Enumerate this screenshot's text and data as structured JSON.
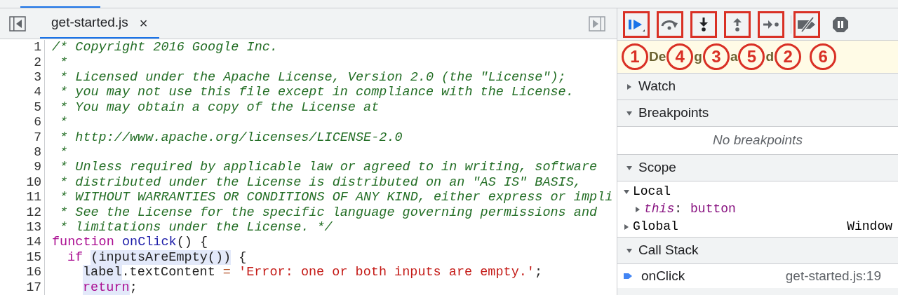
{
  "editor": {
    "tabs": [
      {
        "label": "get-started.js",
        "close": "×",
        "selected": true
      }
    ],
    "lines": [
      {
        "number": "1",
        "tokens": [
          {
            "text": "/* Copyright 2016 Google Inc.",
            "kind": "comment",
            "marked": false
          }
        ]
      },
      {
        "number": "2",
        "tokens": [
          {
            "text": " *",
            "kind": "comment",
            "marked": false
          }
        ]
      },
      {
        "number": "3",
        "tokens": [
          {
            "text": " * Licensed under the Apache License, Version 2.0 (the \"License\");",
            "kind": "comment",
            "marked": false
          }
        ]
      },
      {
        "number": "4",
        "tokens": [
          {
            "text": " * you may not use this file except in compliance with the License.",
            "kind": "comment",
            "marked": false
          }
        ]
      },
      {
        "number": "5",
        "tokens": [
          {
            "text": " * You may obtain a copy of the License at",
            "kind": "comment",
            "marked": false
          }
        ]
      },
      {
        "number": "6",
        "tokens": [
          {
            "text": " *",
            "kind": "comment",
            "marked": false
          }
        ]
      },
      {
        "number": "7",
        "tokens": [
          {
            "text": " * http://www.apache.org/licenses/LICENSE-2.0",
            "kind": "comment",
            "marked": false
          }
        ]
      },
      {
        "number": "8",
        "tokens": [
          {
            "text": " *",
            "kind": "comment",
            "marked": false
          }
        ]
      },
      {
        "number": "9",
        "tokens": [
          {
            "text": " * Unless required by applicable law or agreed to in writing, software",
            "kind": "comment",
            "marked": false
          }
        ]
      },
      {
        "number": "10",
        "tokens": [
          {
            "text": " * distributed under the License is distributed on an \"AS IS\" BASIS,",
            "kind": "comment",
            "marked": false
          }
        ]
      },
      {
        "number": "11",
        "tokens": [
          {
            "text": " * WITHOUT WARRANTIES OR CONDITIONS OF ANY KIND, either express or impli",
            "kind": "comment",
            "marked": false
          }
        ]
      },
      {
        "number": "12",
        "tokens": [
          {
            "text": " * See the License for the specific language governing permissions and",
            "kind": "comment",
            "marked": false
          }
        ]
      },
      {
        "number": "13",
        "tokens": [
          {
            "text": " * limitations under the License. */",
            "kind": "comment",
            "marked": false
          }
        ]
      },
      {
        "number": "14",
        "tokens": [
          {
            "text": "function ",
            "kind": "keyword",
            "marked": false
          },
          {
            "text": "onClick",
            "kind": "def",
            "marked": false
          },
          {
            "text": "() {",
            "kind": "plain",
            "marked": false
          }
        ],
        "children": [
          {
            "number": "15",
            "tokens": [
              {
                "text": "if ",
                "kind": "keyword",
                "marked": false
              },
              {
                "text": "(inputsAreEmpty())",
                "kind": "plain",
                "marked": true
              },
              {
                "text": " {",
                "kind": "plain",
                "marked": false
              }
            ],
            "children": [
              {
                "number": "16",
                "tokens": [
                  {
                    "text": "label",
                    "kind": "plain",
                    "marked": true
                  },
                  {
                    "text": ".textContent ",
                    "kind": "plain",
                    "marked": false
                  },
                  {
                    "text": "= ",
                    "kind": "operator",
                    "marked": false
                  },
                  {
                    "text": "'Error: one or both inputs are empty.'",
                    "kind": "string",
                    "marked": false
                  },
                  {
                    "text": ";",
                    "kind": "plain",
                    "marked": false
                  }
                ]
              },
              {
                "number": "17",
                "tokens": [
                  {
                    "text": "return",
                    "kind": "keyword",
                    "marked": true
                  },
                  {
                    "text": ";",
                    "kind": "plain",
                    "marked": false
                  }
                ]
              }
            ]
          }
        ]
      }
    ]
  },
  "debugger": {
    "toolbar": [
      {
        "kind": "resume",
        "outlined": true,
        "annotation": "1"
      },
      {
        "kind": "step-over",
        "outlined": true,
        "annotation": "4"
      },
      {
        "kind": "step-into",
        "outlined": true,
        "annotation": "3"
      },
      {
        "kind": "step-out",
        "outlined": true,
        "annotation": "5"
      },
      {
        "kind": "step",
        "outlined": true,
        "annotation": "2"
      },
      {
        "kind": "deactivate",
        "outlined": true,
        "annotation": "6"
      },
      {
        "kind": "pause",
        "outlined": false
      }
    ],
    "banner_fragments": [
      "De",
      "g",
      "a",
      "d"
    ],
    "sections": [
      {
        "title": "Watch",
        "expanded": false
      },
      {
        "kind": "breakpoints",
        "title": "Breakpoints",
        "expanded": true,
        "empty": "No breakpoints"
      },
      {
        "kind": "scope",
        "title": "Scope",
        "expanded": true,
        "items": [
          {
            "name": "Local",
            "expanded": true,
            "children": [
              {
                "name": "this",
                "separator": ":",
                "value": "button",
                "expanded": false
              }
            ]
          },
          {
            "name": "Global",
            "value": "Window",
            "expanded": false
          }
        ]
      },
      {
        "kind": "callstack",
        "title": "Call Stack",
        "expanded": true,
        "frames": [
          {
            "name": "onClick",
            "location": "get-started.js:19",
            "selected": true
          }
        ]
      }
    ]
  }
}
